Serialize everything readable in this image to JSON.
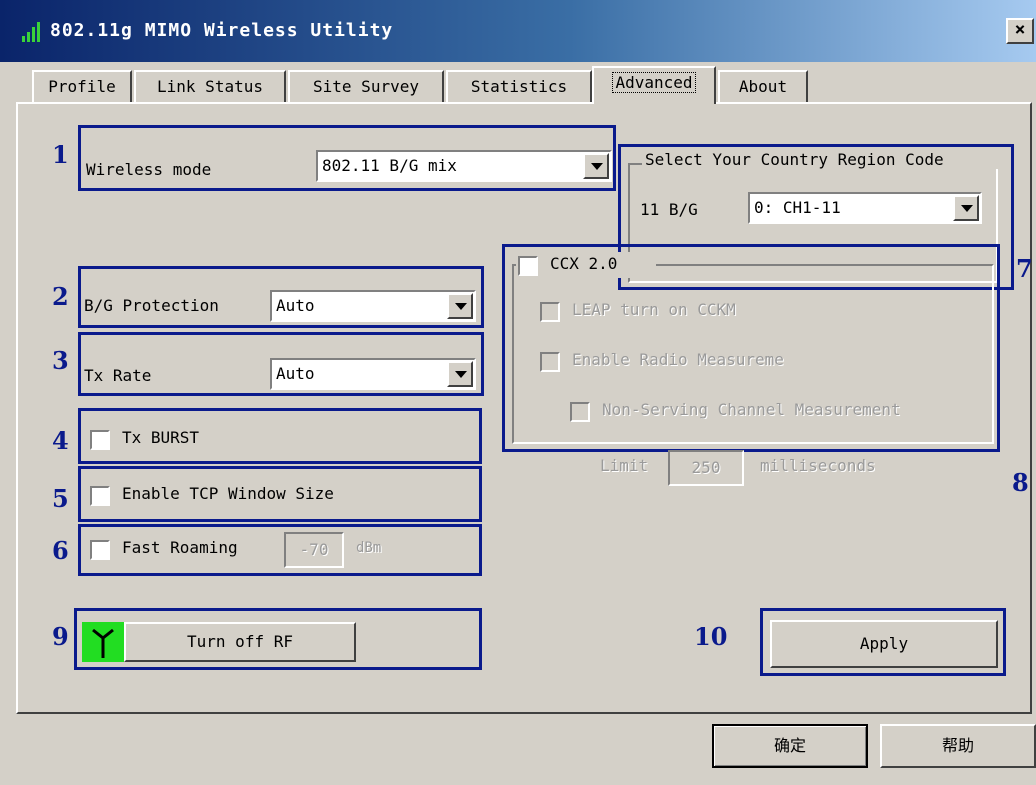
{
  "window": {
    "title": "802.11g MIMO Wireless Utility",
    "close": "×"
  },
  "tabs": [
    "Profile",
    "Link Status",
    "Site Survey",
    "Statistics",
    "Advanced",
    "About"
  ],
  "annotations": [
    "1",
    "2",
    "3",
    "4",
    "5",
    "6",
    "7",
    "8",
    "9",
    "10"
  ],
  "wireless_mode": {
    "label": "Wireless mode",
    "value": "802.11 B/G mix"
  },
  "country": {
    "group_title": "Select Your Country Region Code",
    "band_label": "11 B/G",
    "value": "0: CH1-11"
  },
  "bg_protection": {
    "label": "B/G Protection",
    "value": "Auto"
  },
  "tx_rate": {
    "label": "Tx Rate",
    "value": "Auto"
  },
  "tx_burst": {
    "label": "Tx BURST",
    "checked": false
  },
  "tcp_window": {
    "label": "Enable TCP Window Size",
    "checked": false
  },
  "fast_roaming": {
    "label": "Fast Roaming",
    "value": "-70",
    "unit": "dBm",
    "checked": false
  },
  "ccx": {
    "label": "CCX 2.0",
    "leap": "LEAP turn on CCKM",
    "radio_measure": "Enable Radio Measureme",
    "non_serving": "Non-Serving Channel Measurement",
    "limit_label": "Limit",
    "limit_value": "250",
    "limit_unit": "milliseconds"
  },
  "rf": {
    "button": "Turn off RF",
    "icon": "antenna-icon",
    "icon_color": "#22dd22"
  },
  "apply": "Apply",
  "footer": {
    "ok": "确定",
    "help": "帮助"
  }
}
